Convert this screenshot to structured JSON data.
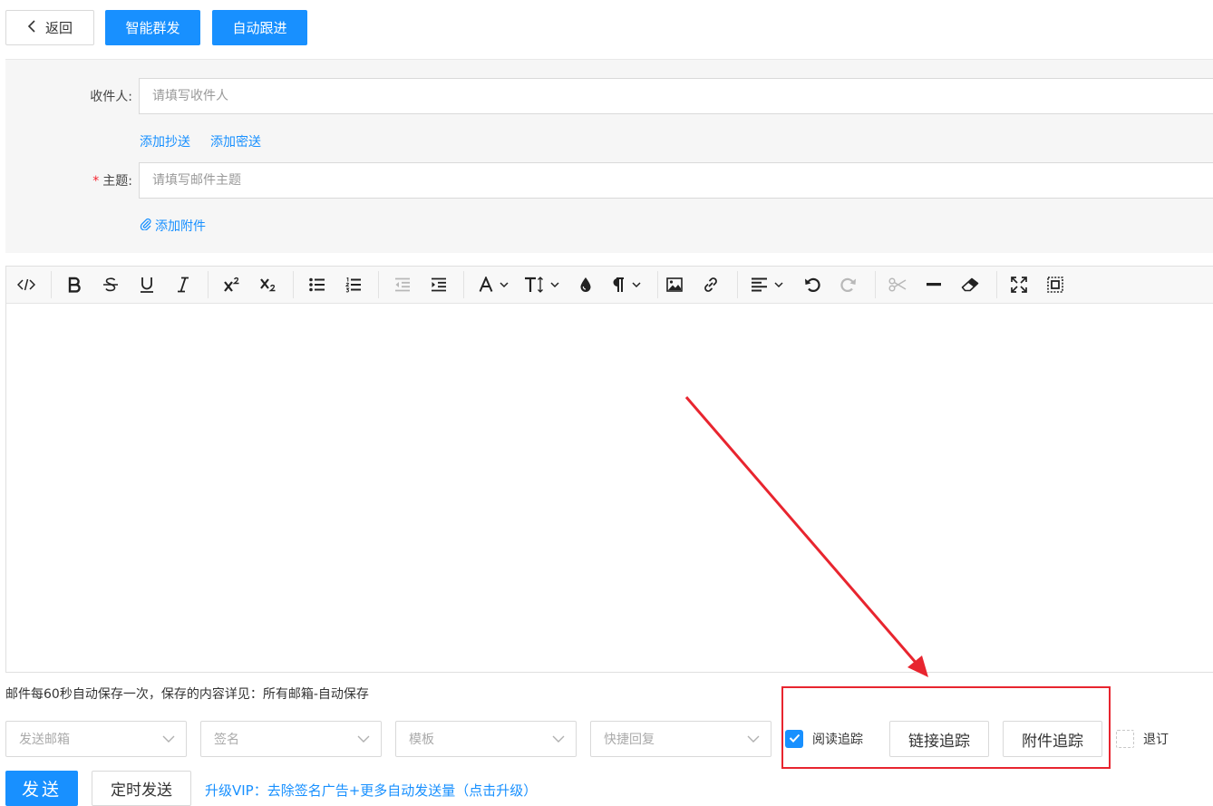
{
  "header": {
    "back_label": "返回",
    "smart_mass_label": "智能群发",
    "auto_follow_label": "自动跟进"
  },
  "form": {
    "recipient_label": "收件人:",
    "recipient_placeholder": "请填写收件人",
    "add_cc": "添加抄送",
    "add_bcc": "添加密送",
    "required_mark": "*",
    "subject_label": "主题:",
    "subject_placeholder": "请填写邮件主题",
    "add_attachment": "添加附件"
  },
  "toolbar": {
    "icons": [
      "source-code-icon",
      "bold-icon",
      "strikethrough-icon",
      "underline-icon",
      "italic-icon",
      "superscript-icon",
      "subscript-icon",
      "bullet-list-icon",
      "numbered-list-icon",
      "outdent-icon",
      "indent-icon",
      "font-color-icon",
      "font-size-icon",
      "background-color-icon",
      "paragraph-icon",
      "image-icon",
      "link-icon",
      "align-icon",
      "undo-icon",
      "redo-icon",
      "cut-icon",
      "horizontal-rule-icon",
      "clear-format-icon",
      "fullscreen-icon",
      "select-all-icon"
    ]
  },
  "footer": {
    "autosave_note": "邮件每60秒自动保存一次，保存的内容详见：所有邮箱-自动保存",
    "sender_placeholder": "发送邮箱",
    "signature_placeholder": "签名",
    "template_placeholder": "模板",
    "quick_reply_placeholder": "快捷回复",
    "read_tracking_label": "阅读追踪",
    "read_tracking_checked": true,
    "link_tracking_label": "链接追踪",
    "attachment_tracking_label": "附件追踪",
    "unsubscribe_label": "退订",
    "unsubscribe_checked": false,
    "send_label": "发送",
    "scheduled_send_label": "定时发送",
    "upgrade_text": "升级VIP：去除签名广告+更多自动发送量（点击升级）"
  },
  "colors": {
    "primary": "#1890ff",
    "annotation": "#e8252f",
    "required": "#f5222d"
  }
}
